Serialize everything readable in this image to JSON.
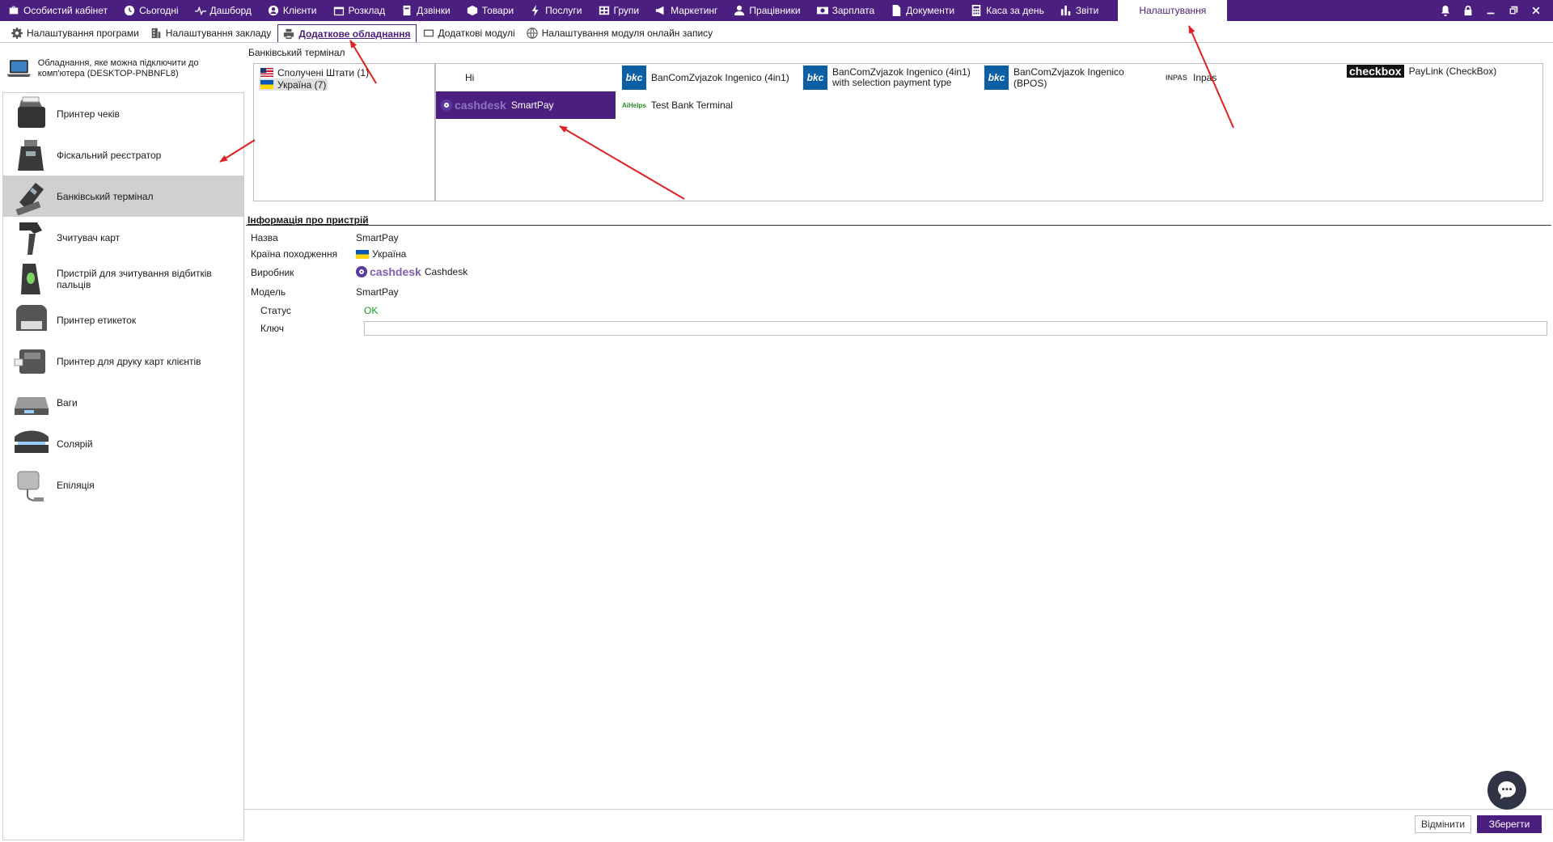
{
  "topnav": {
    "items": [
      {
        "label": "Особистий кабінет",
        "icon": "briefcase-icon"
      },
      {
        "label": "Сьогодні",
        "icon": "clock-icon"
      },
      {
        "label": "Дашборд",
        "icon": "pulse-icon"
      },
      {
        "label": "Клієнти",
        "icon": "user-circle-icon"
      },
      {
        "label": "Розклад",
        "icon": "calendar-icon"
      },
      {
        "label": "Дзвінки",
        "icon": "phone-book-icon"
      },
      {
        "label": "Товари",
        "icon": "box-icon"
      },
      {
        "label": "Послуги",
        "icon": "bolt-icon"
      },
      {
        "label": "Групи",
        "icon": "group-icon"
      },
      {
        "label": "Маркетинг",
        "icon": "megaphone-icon"
      },
      {
        "label": "Працівники",
        "icon": "person-icon"
      },
      {
        "label": "Зарплата",
        "icon": "money-icon"
      },
      {
        "label": "Документи",
        "icon": "document-icon"
      },
      {
        "label": "Каса за день",
        "icon": "calculator-icon"
      },
      {
        "label": "Звіти",
        "icon": "bar-chart-icon"
      }
    ],
    "active_label": "Налаштування"
  },
  "subtabs": [
    {
      "label": "Налаштування програми",
      "icon": "gear-icon"
    },
    {
      "label": "Налаштування закладу",
      "icon": "building-icon"
    },
    {
      "label": "Додаткове обладнання",
      "icon": "printer-icon"
    },
    {
      "label": "Додаткові модулі",
      "icon": "module-icon"
    },
    {
      "label": "Налаштування модуля онлайн запису",
      "icon": "globe-icon"
    }
  ],
  "left": {
    "connected_text": "Обладнання, яке можна підключити до комп'ютера (DESKTOP-PNBNFL8)",
    "devices": [
      {
        "label": "Принтер чеків"
      },
      {
        "label": "Фіскальний реєстратор"
      },
      {
        "label": "Банківський термінал"
      },
      {
        "label": "Зчитувач карт"
      },
      {
        "label": "Пристрій для зчитування відбитків пальців"
      },
      {
        "label": "Принтер етикеток"
      },
      {
        "label": "Принтер для друку карт клієнтів"
      },
      {
        "label": "Ваги"
      },
      {
        "label": "Солярій"
      },
      {
        "label": "Епіляція"
      }
    ]
  },
  "main": {
    "section_label": "Банківський термінал",
    "countries": [
      {
        "label": "Сполучені Штати (1)"
      },
      {
        "label": "Україна (7)"
      }
    ],
    "terminals": {
      "hi": "Hi",
      "smartpay": "SmartPay",
      "bkc1": "BanComZvjazok Ingenico (4in1)",
      "bkc2": "BanComZvjazok Ingenico (4in1) with selection payment type",
      "bkc3": "BanComZvjazok Ingenico (BPOS)",
      "inpas": "Inpas",
      "paylink": "PayLink (CheckBox)",
      "test": "Test Bank Terminal",
      "cashdesk_logo": "cashdesk",
      "bkc_logo": "bkc",
      "inpas_logo": "INPAS",
      "checkbox_logo": "checkbox",
      "ai_logo": "AiHelps"
    },
    "info": {
      "title": "Інформація про пристрій",
      "name_label": "Назва",
      "name_value": "SmartPay",
      "country_label": "Країна походження",
      "country_value": "Україна",
      "vendor_label": "Виробник",
      "vendor_logo": "cashdesk",
      "vendor_value": "Cashdesk",
      "model_label": "Модель",
      "model_value": "SmartPay",
      "status_label": "Статус",
      "status_value": "OK",
      "key_label": "Ключ",
      "key_value": ""
    }
  },
  "footer": {
    "cancel_label": "Відмінити",
    "save_label": "Зберегти"
  },
  "colors": {
    "brand": "#4b1f80",
    "status_ok": "#1a9a1a",
    "annotation_arrow": "#e02020"
  }
}
